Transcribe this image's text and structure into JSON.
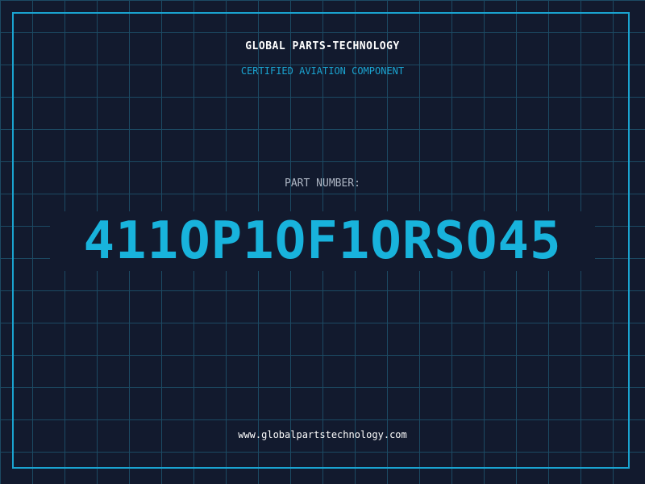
{
  "header": {
    "company_name": "GLOBAL PARTS-TECHNOLOGY",
    "certification": "CERTIFIED AVIATION COMPONENT"
  },
  "part": {
    "label": "PART NUMBER:",
    "number": "411OP1OF1ORSO45"
  },
  "footer": {
    "website": "www.globalpartstechnology.com"
  },
  "colors": {
    "background": "#121a2e",
    "grid": "#1c4a63",
    "accent": "#18b3dc",
    "frame": "#1aa3d0",
    "label": "#aeb6c4",
    "text": "#ffffff"
  }
}
